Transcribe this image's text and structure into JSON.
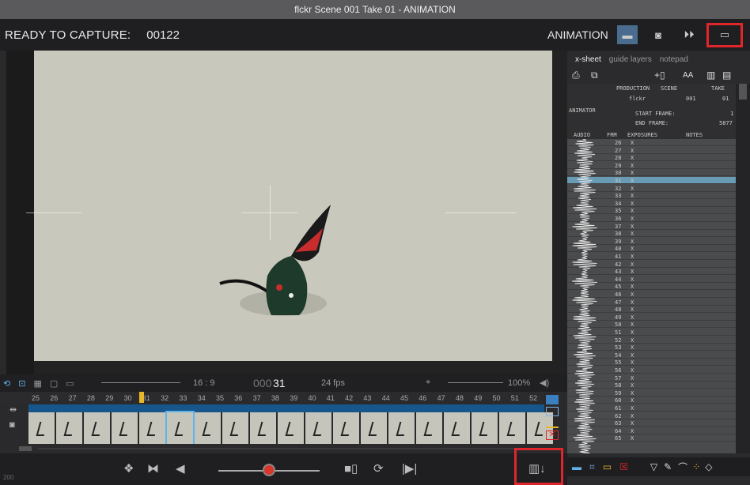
{
  "window": {
    "title": "flckr  Scene 001  Take 01 - ANIMATION"
  },
  "topbar": {
    "status": "READY TO CAPTURE:",
    "frame_number": "00122",
    "mode": "ANIMATION",
    "buttons": [
      "monitor-icon",
      "camera-icon",
      "playback-icon",
      "xsheet-layout-icon"
    ]
  },
  "controls": {
    "aspect": "16 : 9",
    "current_frame_prefix": "000",
    "current_frame": "31",
    "fps": "24 fps",
    "zoom": "100%"
  },
  "ruler": [
    "25",
    "26",
    "27",
    "28",
    "29",
    "30",
    "31",
    "32",
    "33",
    "34",
    "35",
    "36",
    "37",
    "38",
    "39",
    "40",
    "41",
    "42",
    "43",
    "44",
    "45",
    "46",
    "47",
    "48",
    "49",
    "50",
    "51",
    "52"
  ],
  "bottom": {
    "left_value": "200"
  },
  "panel": {
    "tabs": [
      "x-sheet",
      "guide layers",
      "notepad"
    ],
    "tools_text": "AA",
    "production_label": "PRODUCTION",
    "scene_label": "SCENE",
    "take_label": "TAKE",
    "production": "flckr",
    "scene": "001",
    "take": "01",
    "animator_label": "ANIMATOR",
    "start_frame_label": "START FRAME:",
    "start_frame": "1",
    "end_frame_label": "END FRAME:",
    "end_frame": "5877",
    "columns": [
      "AUDIO",
      "FRM",
      "EXPOSURES",
      "NOTES"
    ],
    "rows": [
      "26",
      "27",
      "28",
      "29",
      "30",
      "31",
      "32",
      "33",
      "34",
      "35",
      "36",
      "37",
      "38",
      "39",
      "40",
      "41",
      "42",
      "43",
      "44",
      "45",
      "46",
      "47",
      "48",
      "49",
      "50",
      "51",
      "52",
      "53",
      "54",
      "55",
      "56",
      "57",
      "58",
      "59",
      "60",
      "61",
      "62",
      "63",
      "64",
      "65"
    ],
    "exposure_mark": "X",
    "selected_frame": "31"
  },
  "colors": {
    "highlight": "#e0262b",
    "accent": "#4a6d8f",
    "timeline": "#17568a"
  }
}
